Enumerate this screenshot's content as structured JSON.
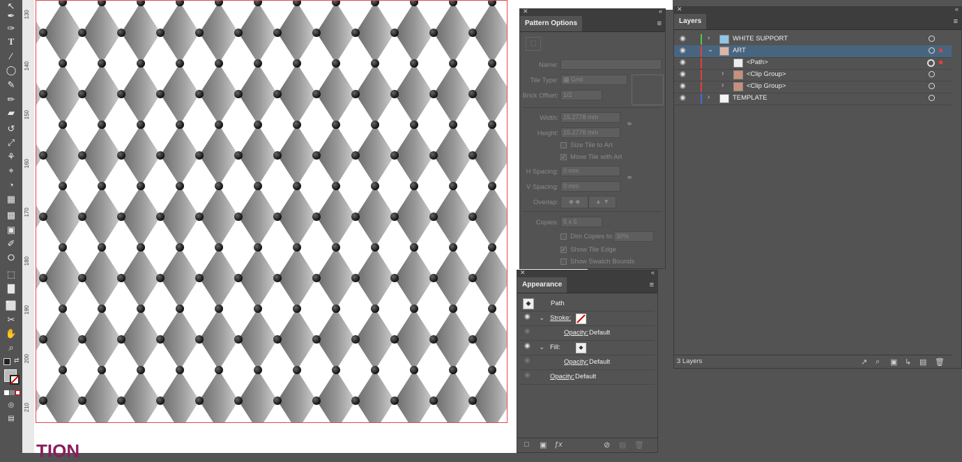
{
  "toolbar": {
    "tools": [
      "selection-icon",
      "pen-icon",
      "curvature-icon",
      "type-icon",
      "line-icon",
      "ellipse-icon",
      "paintbrush-icon",
      "shaper-icon",
      "eraser-icon",
      "rotate-icon",
      "scale-icon",
      "puppet-warp-icon",
      "pin-icon",
      "shape-builder-icon",
      "perspective-icon",
      "mesh-icon",
      "gradient-icon",
      "eyedropper-icon",
      "blend-icon",
      "symbol-sprayer-icon",
      "graph-icon",
      "artboard-icon",
      "slice-icon",
      "hand-icon",
      "zoom-icon"
    ]
  },
  "ruler": {
    "labels": [
      "130",
      "140",
      "150",
      "160",
      "170",
      "180",
      "190",
      "200",
      "210"
    ]
  },
  "canvas": {
    "bottom_text": "TION"
  },
  "pattern_options": {
    "tab": "Pattern Options",
    "name_label": "Name:",
    "tile_type_label": "Tile Type:",
    "tile_type_value": "Grid",
    "brick_offset_label": "Brick Offset:",
    "brick_offset_value": "1/2",
    "width_label": "Width:",
    "width_value": "15.2778 mm",
    "height_label": "Height:",
    "height_value": "15.2778 mm",
    "size_tile_label": "Size Tile to Art",
    "move_tile_label": "Move Tile with Art",
    "h_spacing_label": "H Spacing:",
    "h_spacing_value": "0 mm",
    "v_spacing_label": "V Spacing:",
    "v_spacing_value": "0 mm",
    "overlap_label": "Overlap:",
    "copies_label": "Copies:",
    "copies_value": "5 x 5",
    "dim_copies_label": "Dim Copies to:",
    "dim_copies_value": "30%",
    "show_tile_edge_label": "Show Tile Edge",
    "show_swatch_bounds_label": "Show Swatch Bounds"
  },
  "appearance": {
    "tab": "Appearance",
    "object": "Path",
    "stroke_label": "Stroke:",
    "opacity_label": "Opacity:",
    "opacity_default": "Default",
    "fill_label": "Fill:"
  },
  "layers": {
    "tab": "Layers",
    "rows": [
      {
        "name": "WHITE SUPPORT",
        "color": "#4fc94a"
      },
      {
        "name": "ART",
        "color": "#e0403a"
      },
      {
        "name": "<Path>",
        "color": "#e0403a"
      },
      {
        "name": "<Clip Group>",
        "color": "#e0403a"
      },
      {
        "name": "<Clip Group>",
        "color": "#e0403a"
      },
      {
        "name": "TEMPLATE",
        "color": "#3c6ee0"
      }
    ],
    "footer_count": "3 Layers"
  }
}
